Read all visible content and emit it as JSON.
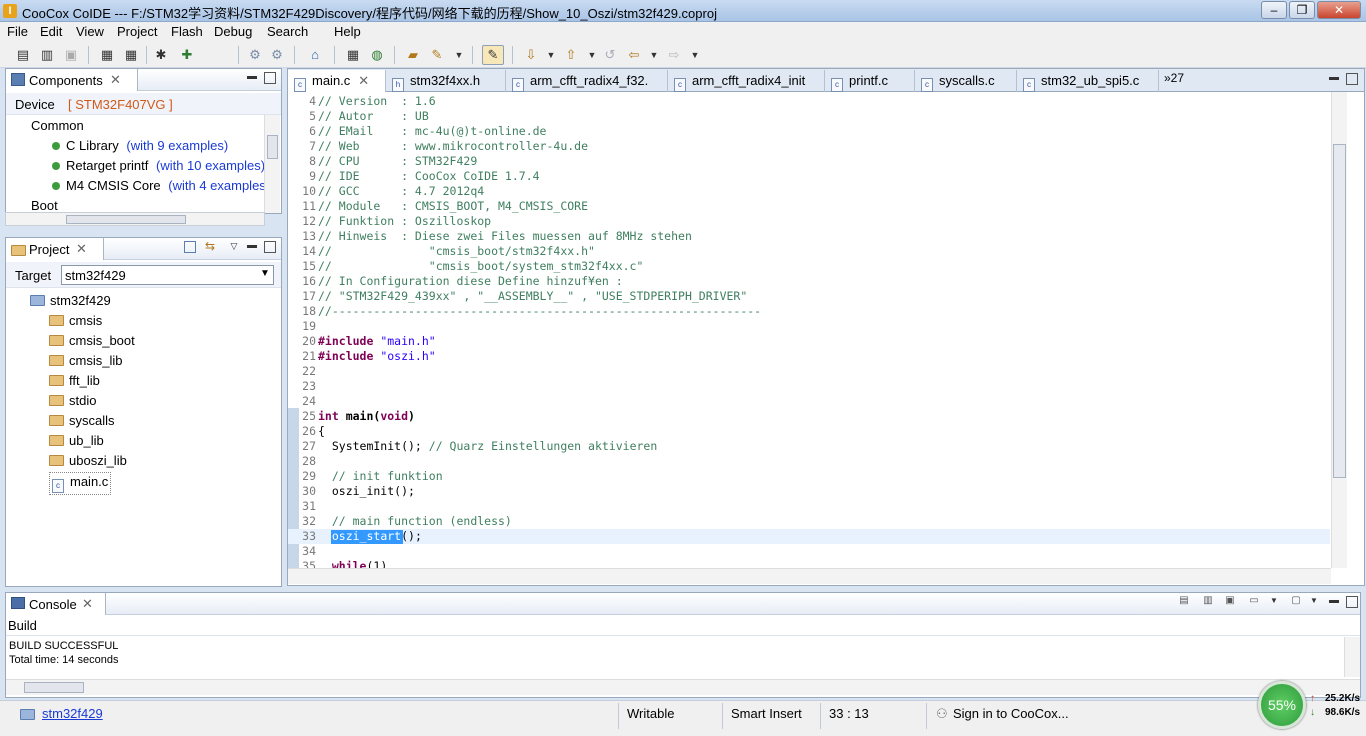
{
  "window": {
    "title": "CooCox CoIDE --- F:/STM32学习资料/STM32F429Discovery/程序代码/网络下载的历程/Show_10_Oszi/stm32f429.coproj",
    "app_icon": "I"
  },
  "menu": [
    "File",
    "Edit",
    "View",
    "Project",
    "Flash",
    "Debug",
    "Search",
    "Help"
  ],
  "components": {
    "title": "Components",
    "device_label": "Device",
    "device_value": "[ STM32F407VG ]",
    "groups": [
      {
        "label": "Common"
      },
      {
        "label": "C Library",
        "examples": "(with 9 examples)"
      },
      {
        "label": "Retarget printf",
        "examples": "(with 10 examples)"
      },
      {
        "label": "M4 CMSIS Core",
        "examples": "(with 4 examples)"
      },
      {
        "label": "Boot"
      }
    ]
  },
  "project": {
    "title": "Project",
    "target_label": "Target",
    "target_value": "stm32f429",
    "root": "stm32f429",
    "folders": [
      "cmsis",
      "cmsis_boot",
      "cmsis_lib",
      "fft_lib",
      "stdio",
      "syscalls",
      "ub_lib",
      "uboszi_lib"
    ],
    "file": "main.c"
  },
  "editor": {
    "tabs": [
      "main.c",
      "stm32f4xx.h",
      "arm_cfft_radix4_f32.",
      "arm_cfft_radix4_init",
      "printf.c",
      "syscalls.c",
      "stm32_ub_spi5.c"
    ],
    "overflow": "»27",
    "lines": [
      {
        "n": "4",
        "t": "// Version  : 1.6"
      },
      {
        "n": "5",
        "t": "// Autor    : UB"
      },
      {
        "n": "6",
        "t": "// EMail    : mc-4u(@)t-online.de"
      },
      {
        "n": "7",
        "t": "// Web      : www.mikrocontroller-4u.de"
      },
      {
        "n": "8",
        "t": "// CPU      : STM32F429"
      },
      {
        "n": "9",
        "t": "// IDE      : CooCox CoIDE 1.7.4"
      },
      {
        "n": "10",
        "t": "// GCC      : 4.7 2012q4"
      },
      {
        "n": "11",
        "t": "// Module   : CMSIS_BOOT, M4_CMSIS_CORE"
      },
      {
        "n": "12",
        "t": "// Funktion : Oszilloskop"
      },
      {
        "n": "13",
        "t": "// Hinweis  : Diese zwei Files muessen auf 8MHz stehen"
      },
      {
        "n": "14",
        "t": "//              \"cmsis_boot/stm32f4xx.h\""
      },
      {
        "n": "15",
        "t": "//              \"cmsis_boot/system_stm32f4xx.c\""
      },
      {
        "n": "16",
        "t": "// In Configuration diese Define hinzuf¥en :"
      },
      {
        "n": "17",
        "t": "// \"STM32F429_439xx\" , \"__ASSEMBLY__\" , \"USE_STDPERIPH_DRIVER\""
      },
      {
        "n": "18",
        "t": "//--------------------------------------------------------------"
      },
      {
        "n": "19",
        "t": ""
      },
      {
        "n": "20",
        "t": "#include \"main.h\""
      },
      {
        "n": "21",
        "t": "#include \"oszi.h\""
      },
      {
        "n": "22",
        "t": ""
      },
      {
        "n": "23",
        "t": ""
      },
      {
        "n": "24",
        "t": ""
      },
      {
        "n": "25",
        "t": "int main(void)"
      },
      {
        "n": "26",
        "t": "{"
      },
      {
        "n": "27",
        "t": "  SystemInit(); // Quarz Einstellungen aktivieren"
      },
      {
        "n": "28",
        "t": ""
      },
      {
        "n": "29",
        "t": "  // init funktion"
      },
      {
        "n": "30",
        "t": "  oszi_init();"
      },
      {
        "n": "31",
        "t": ""
      },
      {
        "n": "32",
        "t": "  // main function (endless)"
      },
      {
        "n": "33",
        "t": "  oszi_start();"
      },
      {
        "n": "34",
        "t": ""
      },
      {
        "n": "35",
        "t": "  while(1)"
      }
    ]
  },
  "console": {
    "title": "Console",
    "sub": "Build",
    "lines": [
      "BUILD SUCCESSFUL",
      "Total time: 14 seconds"
    ]
  },
  "status": {
    "project": "stm32f429",
    "writable": "Writable",
    "insert": "Smart Insert",
    "position": "33 : 13",
    "signin": "Sign in to CooCox...",
    "net_percent": "55%",
    "up": "25.2K/s",
    "down": "98.6K/s"
  },
  "colors": {
    "accent": "#3a6ea5",
    "comment": "#3f7f5f",
    "keyword": "#7f0055",
    "string": "#2a00ff",
    "device": "#d05a1a",
    "link": "#1a3ad6",
    "gauge": "#3aa64a"
  }
}
